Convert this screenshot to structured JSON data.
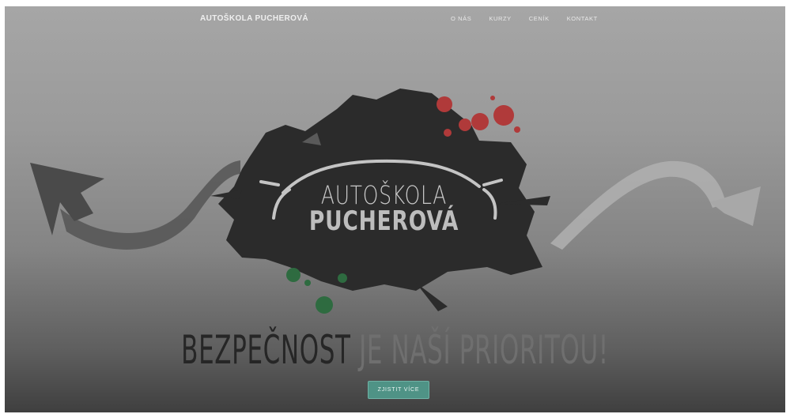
{
  "navbar": {
    "brand": "AUTOŠKOLA PUCHEROVÁ",
    "items": [
      {
        "label": "O NÁS"
      },
      {
        "label": "KURZY"
      },
      {
        "label": "CENÍK"
      },
      {
        "label": "KONTAKT"
      }
    ]
  },
  "hero": {
    "logo_line1": "AUTOŠKOLA",
    "logo_line2": "PUCHEROVÁ",
    "tagline_part1": "BEZPEČNOST",
    "tagline_part2": " JE NAŠÍ PRIORITOU!",
    "cta_label": "ZJISTIT VÍCE"
  },
  "colors": {
    "accent": "#4f9386",
    "splash_red": "#b03a3a",
    "splash_green": "#2e6b40"
  }
}
